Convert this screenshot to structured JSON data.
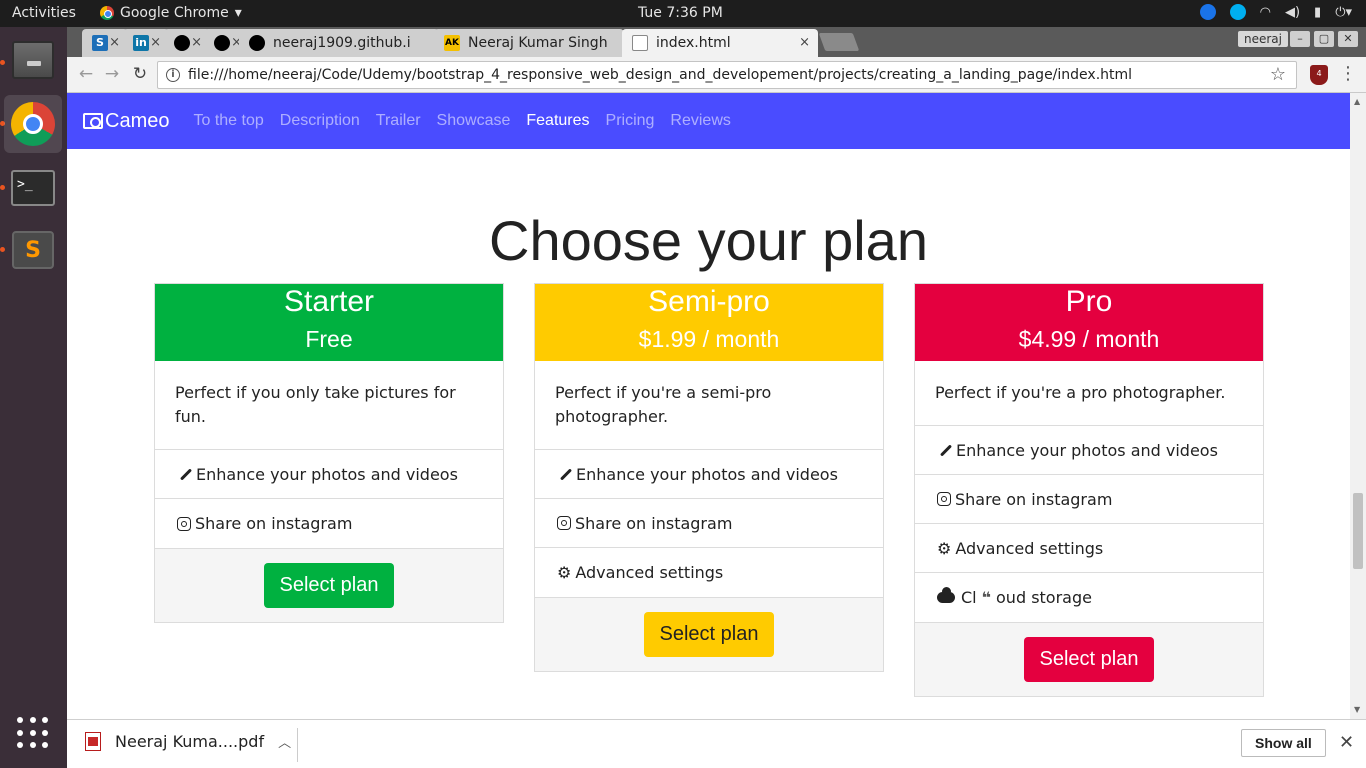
{
  "system": {
    "activities": "Activities",
    "app_name": "Google Chrome",
    "clock": "Tue  7:36 PM"
  },
  "browser": {
    "tabs": [
      {
        "label": "",
        "icon": "S"
      },
      {
        "label": "",
        "icon": "in"
      },
      {
        "label": "",
        "icon": "github"
      },
      {
        "label": "",
        "icon": "github"
      },
      {
        "label": "neeraj1909.github.i",
        "icon": "github"
      },
      {
        "label": "Neeraj Kumar Singh",
        "icon": "AK"
      },
      {
        "label": "index.html",
        "icon": "doc"
      }
    ],
    "user": "neeraj",
    "url": "file:///home/neeraj/Code/Udemy/bootstrap_4_responsive_web_design_and_developement/projects/creating_a_landing_page/index.html",
    "ext_badge": "4"
  },
  "page": {
    "brand": "Cameo",
    "nav": [
      "To the top",
      "Description",
      "Trailer",
      "Showcase",
      "Features",
      "Pricing",
      "Reviews"
    ],
    "active_nav": "Features",
    "title": "Choose your plan",
    "plans": [
      {
        "name": "Starter",
        "price": "Free",
        "color": "#00b140",
        "description": "Perfect if you only take pictures for fun.",
        "features": [
          "Enhance your photos and videos",
          "Share on instagram"
        ],
        "button": "Select plan"
      },
      {
        "name": "Semi-pro",
        "price": "$1.99 / month",
        "color": "#ffcb00",
        "description": "Perfect if you're a semi-pro photographer.",
        "features": [
          "Enhance your photos and videos",
          "Share on instagram",
          "Advanced settings"
        ],
        "button": "Select plan"
      },
      {
        "name": "Pro",
        "price": "$4.99 / month",
        "color": "#e4003f",
        "description": "Perfect if you're a pro photographer.",
        "features": [
          "Enhance your photos and videos",
          "Share on instagram",
          "Advanced settings",
          "Cl",
          "oud storage"
        ],
        "button": "Select plan"
      }
    ]
  },
  "downloads": {
    "file": "Neeraj Kuma....pdf",
    "show_all": "Show all"
  },
  "colors": {
    "navbar": "#4a4cff"
  }
}
